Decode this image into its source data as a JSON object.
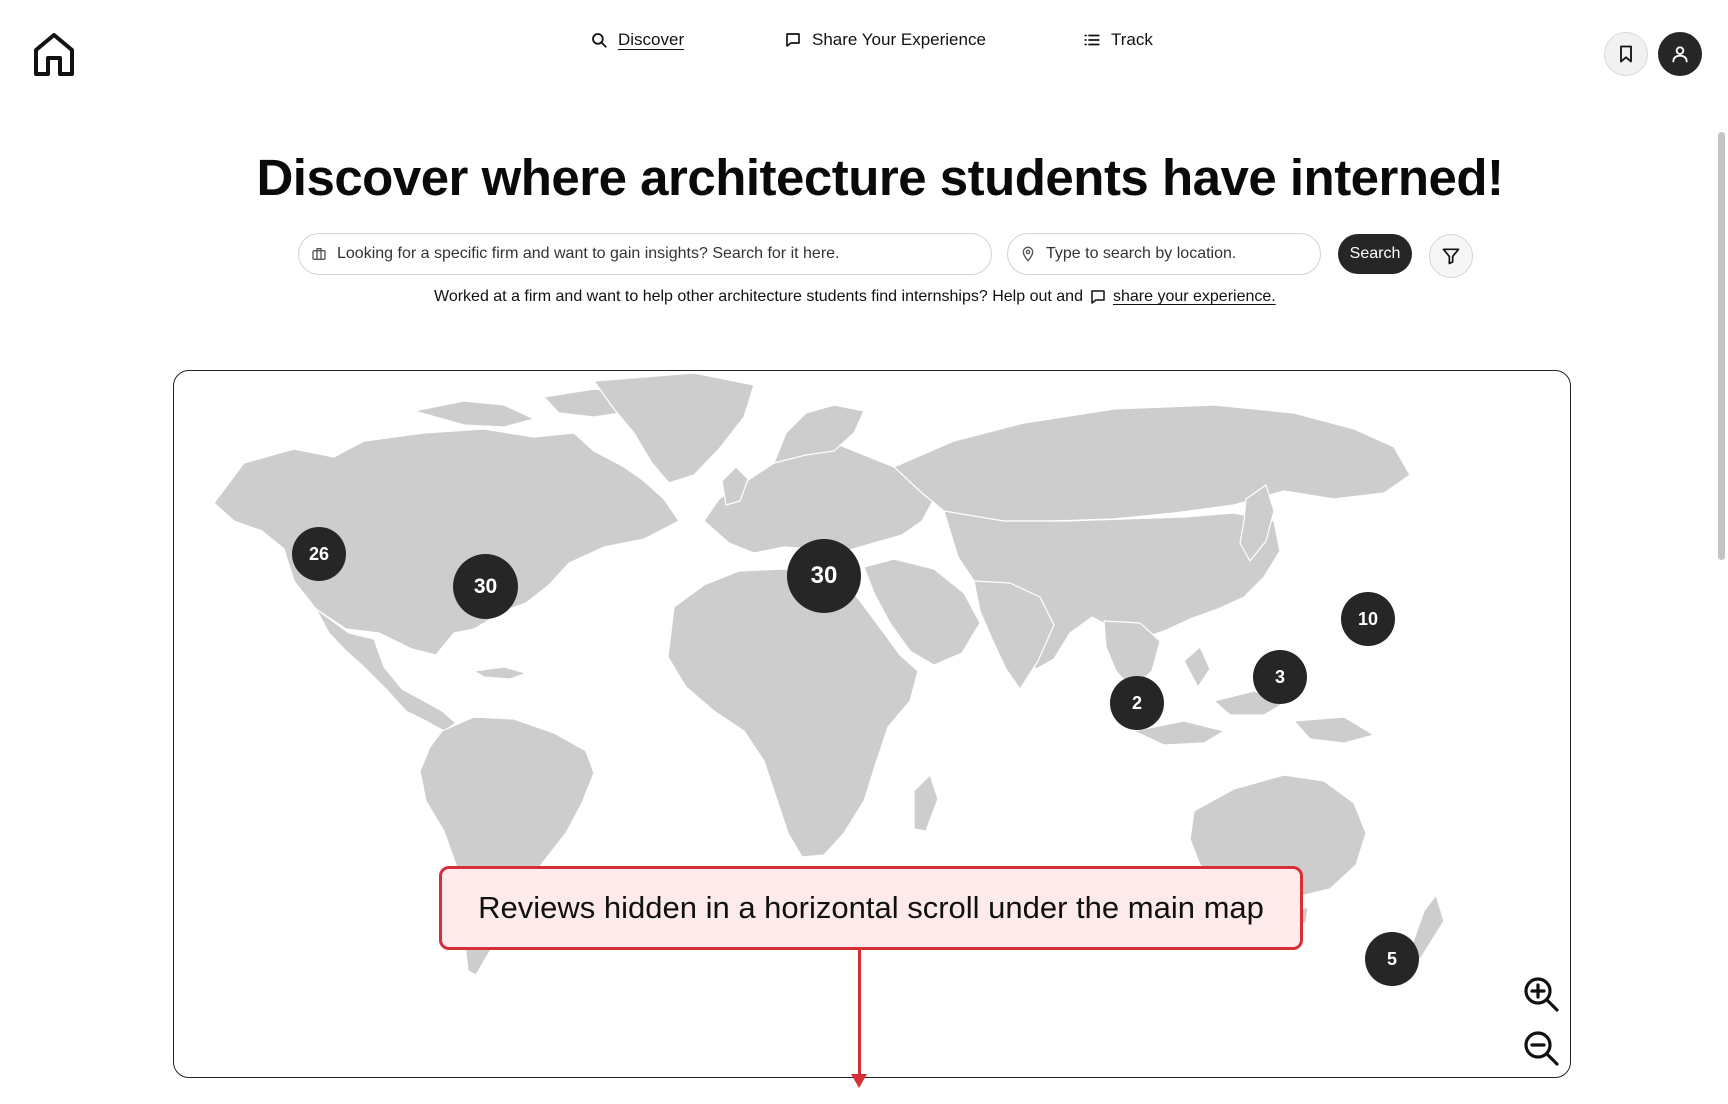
{
  "nav": {
    "items": [
      {
        "label": "Discover",
        "icon": "search-icon",
        "active": true
      },
      {
        "label": "Share Your Experience",
        "icon": "message-square-icon",
        "active": false
      },
      {
        "label": "Track",
        "icon": "list-icon",
        "active": false
      }
    ]
  },
  "header": {
    "logo_icon": "home-icon",
    "bookmark_icon": "bookmark-icon",
    "user_icon": "user-icon"
  },
  "hero": {
    "title": "Discover where architecture students have interned!"
  },
  "search": {
    "firm_placeholder": "Looking for a specific firm and want to gain insights? Search for it here.",
    "location_placeholder": "Type to search by location.",
    "button_label": "Search",
    "filter_icon": "filter-icon"
  },
  "helper": {
    "text": "Worked at a firm and want to help other architecture students find internships? Help out and",
    "link_label": "share your experience."
  },
  "map": {
    "clusters": [
      {
        "region": "us-west",
        "count": "26"
      },
      {
        "region": "us-east",
        "count": "30"
      },
      {
        "region": "europe",
        "count": "30"
      },
      {
        "region": "east-asia",
        "count": "10"
      },
      {
        "region": "southeast-asia",
        "count": "3"
      },
      {
        "region": "india",
        "count": "2"
      },
      {
        "region": "australia",
        "count": "5"
      }
    ],
    "zoom_in_icon": "zoom-in-icon",
    "zoom_out_icon": "zoom-out-icon"
  },
  "annotation": {
    "text": "Reviews hidden in a horizontal scroll under the main map",
    "border_color": "#d62f35",
    "fill_color": "#fdeaea"
  },
  "colors": {
    "cluster": "#262626",
    "land": "#cdcdcd",
    "accent_dark": "#262626"
  }
}
